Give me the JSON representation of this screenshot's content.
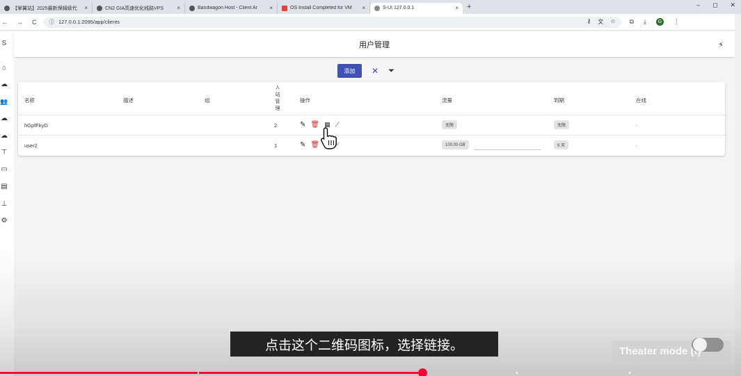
{
  "browser": {
    "tabs": [
      {
        "title": "【掌翼站】2025最新保姆级代",
        "icon": "globe-icon",
        "active": false
      },
      {
        "title": "CN2 GIA高速优化线路VPS",
        "icon": "globe-icon",
        "active": false
      },
      {
        "title": "Bandwagon Host - Client Ar",
        "icon": "globe-icon",
        "active": false
      },
      {
        "title": "OS Install Completed for VM",
        "icon": "gmail-icon",
        "active": false
      },
      {
        "title": "S-UI 127.0.0.1",
        "icon": "sui-icon",
        "active": true
      }
    ],
    "new_tab": "+",
    "close": "×",
    "window_controls": {
      "minimize": "–",
      "maximize": "◻",
      "close": "✕"
    },
    "nav": {
      "back": "←",
      "forward": "→",
      "reload": "C"
    },
    "url": "127.0.0.1:2095/app/clients",
    "profile_initial": "G"
  },
  "sidebar": {
    "items": [
      {
        "name": "logo",
        "icon": "S"
      },
      {
        "name": "home",
        "icon": "⌂"
      },
      {
        "name": "inbounds",
        "icon": "☁"
      },
      {
        "name": "clients",
        "icon": "👥"
      },
      {
        "name": "outbounds",
        "icon": "☁"
      },
      {
        "name": "endpoints",
        "icon": "☁"
      },
      {
        "name": "rules",
        "icon": "⊤"
      },
      {
        "name": "tls",
        "icon": "▭"
      },
      {
        "name": "dns",
        "icon": "▤"
      },
      {
        "name": "basics",
        "icon": "⊥"
      },
      {
        "name": "settings",
        "icon": "⚙"
      }
    ]
  },
  "header": {
    "title": "用户管理"
  },
  "toolbar": {
    "add_label": "添加"
  },
  "table": {
    "headers": {
      "name": "名称",
      "desc": "描述",
      "group": "组",
      "inbound": [
        "入",
        "站",
        "管",
        "理"
      ],
      "actions": "操作",
      "traffic": "流量",
      "expiry": "到期",
      "online": "在线"
    },
    "rows": [
      {
        "name": "hGpfFkyD",
        "desc": "",
        "group": "",
        "inbound": "2",
        "traffic": "无限",
        "expiry": "无限",
        "online": "-"
      },
      {
        "name": "user2",
        "desc": "",
        "group": "",
        "inbound": "1",
        "traffic": "100.00 GB",
        "expiry": "9 天",
        "online": "-"
      }
    ]
  },
  "video": {
    "subtitle": "点击这个二维码图标，选择链接。",
    "theater_label": "Theater mode (t)",
    "progress_fraction": 0.57
  }
}
